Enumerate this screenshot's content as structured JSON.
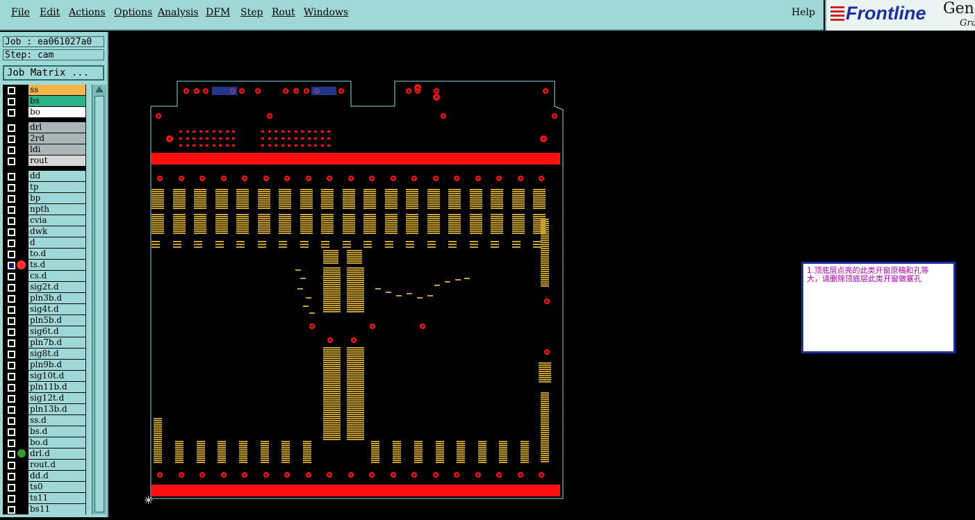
{
  "menubar": {
    "items": [
      "File",
      "Edit",
      "Actions",
      "Options",
      "Analysis",
      "DFM",
      "Step",
      "Rout",
      "Windows"
    ],
    "help": "Help"
  },
  "logo": {
    "brand": "Frontline",
    "product": "Gene",
    "subtitle": "Gra"
  },
  "job": {
    "job_label": "Job : ea061027a0",
    "step_label": "Step: cam",
    "matrix_button": "Job Matrix ..."
  },
  "layers": [
    {
      "name": "ss",
      "color": "#f2b64a"
    },
    {
      "name": "bs",
      "color": "#2cb488"
    },
    {
      "name": "bo",
      "color": "#ffffff"
    },
    {
      "name": "drl",
      "color": "#a9b7b9"
    },
    {
      "name": "2rd",
      "color": "#a9b7b9"
    },
    {
      "name": "ldi",
      "color": "#a9b7b9"
    },
    {
      "name": "rout",
      "color": "#d8d8d8"
    },
    {
      "name": "dd"
    },
    {
      "name": "tp"
    },
    {
      "name": "bp"
    },
    {
      "name": "npth"
    },
    {
      "name": "cvia"
    },
    {
      "name": "dwk"
    },
    {
      "name": "d"
    },
    {
      "name": "to.d"
    },
    {
      "name": "ts.d"
    },
    {
      "name": "cs.d"
    },
    {
      "name": "sig2t.d"
    },
    {
      "name": "pln3b.d"
    },
    {
      "name": "sig4t.d"
    },
    {
      "name": "pln5b.d"
    },
    {
      "name": "sig6t.d"
    },
    {
      "name": "pln7b.d"
    },
    {
      "name": "sig8t.d"
    },
    {
      "name": "pln9b.d"
    },
    {
      "name": "sig10t.d"
    },
    {
      "name": "pln11b.d"
    },
    {
      "name": "sig12t.d"
    },
    {
      "name": "pln13b.d"
    },
    {
      "name": "ss.d"
    },
    {
      "name": "bs.d"
    },
    {
      "name": "bo.d"
    },
    {
      "name": "drl.d"
    },
    {
      "name": "rout.d"
    },
    {
      "name": "dd.d"
    },
    {
      "name": "ts0"
    },
    {
      "name": "ts11"
    },
    {
      "name": "bs11"
    }
  ],
  "note": {
    "line1": "1.顶底层点亮的此类开窗原稿和孔等",
    "line2": "大，请删除顶底层此类开窗做塞孔"
  },
  "colors": {
    "panel": "#9fd8d6",
    "board_outline": "#7fe0e0",
    "copper_red": "#ff1010",
    "pad_gold": "#c8a030",
    "note_text": "#b000b0",
    "note_border": "#1a30a0"
  }
}
